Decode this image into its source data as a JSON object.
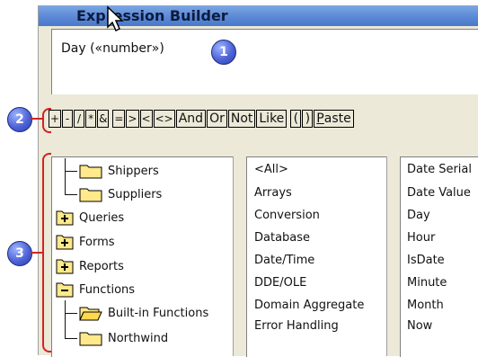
{
  "window": {
    "title": "Expression Builder"
  },
  "expression": {
    "text": "Day («number»)"
  },
  "callouts": [
    "1",
    "2",
    "3"
  ],
  "operators": [
    "+",
    "-",
    "/",
    "*",
    "&",
    "=",
    ">",
    "<",
    "<>",
    "And",
    "Or",
    "Not",
    "Like",
    "(",
    ")"
  ],
  "paste": {
    "first": "P",
    "rest": "aste"
  },
  "tree": {
    "items": [
      {
        "label": "Shippers",
        "icon": "folder-icon"
      },
      {
        "label": "Suppliers",
        "icon": "folder-icon"
      },
      {
        "label": "Queries",
        "icon": "plus-folder-icon"
      },
      {
        "label": "Forms",
        "icon": "plus-folder-icon"
      },
      {
        "label": "Reports",
        "icon": "plus-folder-icon"
      },
      {
        "label": "Functions",
        "icon": "minus-folder-icon"
      },
      {
        "label": "Built-in Functions",
        "icon": "open-folder-icon"
      },
      {
        "label": "Northwind",
        "icon": "folder-icon"
      }
    ]
  },
  "categories": [
    "<All>",
    "Arrays",
    "Conversion",
    "Database",
    "Date/Time",
    "DDE/OLE",
    "Domain Aggregate",
    "Error Handling"
  ],
  "functions": [
    "Date Serial",
    "Date Value",
    "Day",
    "Hour",
    "IsDate",
    "Minute",
    "Month",
    "Now"
  ],
  "colors": {
    "accent": "#d22323",
    "callout": "#4d63d8",
    "titlebar": "#5b89d6"
  }
}
